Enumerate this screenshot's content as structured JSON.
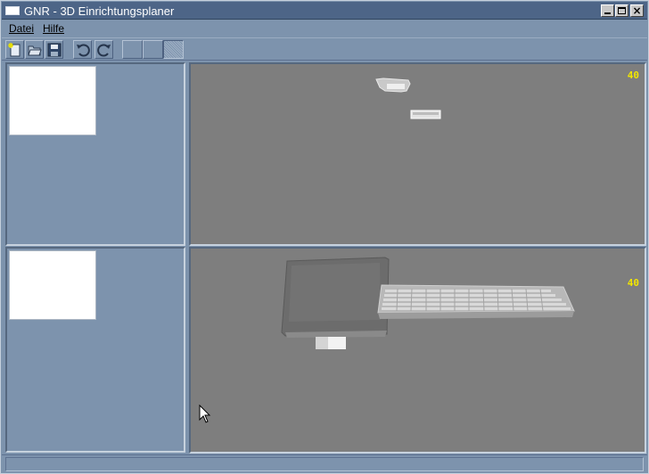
{
  "window": {
    "title": "GNR - 3D Einrichtungsplaner"
  },
  "menu": {
    "file": "Datei",
    "help": "Hilfe"
  },
  "toolbar": {
    "buttons": [
      "new-file-icon",
      "open-folder-icon",
      "save-disk-icon",
      "undo-icon",
      "redo-icon",
      "view-mode-1",
      "view-mode-2",
      "view-mode-3"
    ],
    "active_view": "view-mode-3"
  },
  "viewports": {
    "top_fps": "40",
    "bottom_fps": "40"
  },
  "colors": {
    "titlebar": "#4d6587",
    "frame": "#7d93ad",
    "viewport": "#7e7e7e",
    "fps_text": "#f2e600"
  },
  "status": {
    "text": ""
  }
}
